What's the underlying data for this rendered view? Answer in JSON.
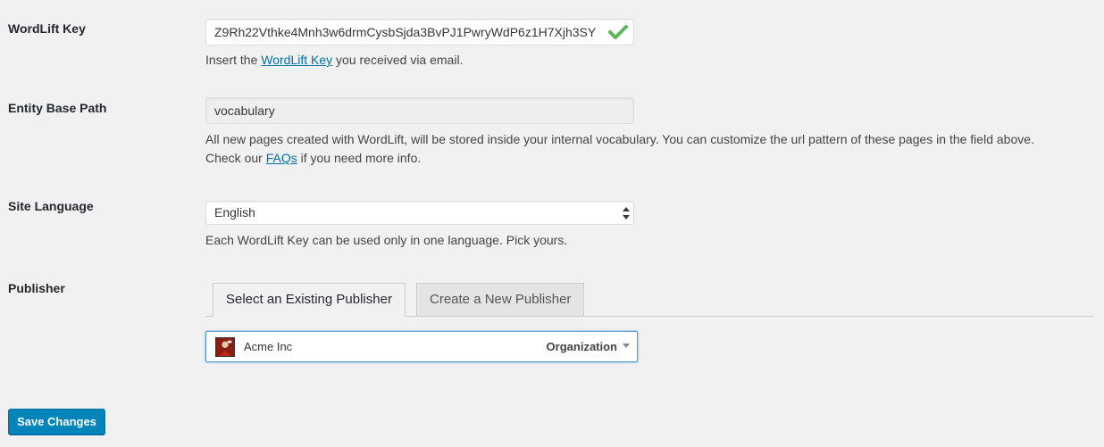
{
  "fields": {
    "key": {
      "label": "WordLift Key",
      "value": "Z9Rh22Vthke4Mnh3w6drmCysbSjda3BvPJ1PwryWdP6z1H7Xjh3SY",
      "desc_before": "Insert the ",
      "desc_link": "WordLift Key",
      "desc_after": " you received via email.",
      "status_icon": "check-icon",
      "status_color": "#5cb85c"
    },
    "base_path": {
      "label": "Entity Base Path",
      "value": "vocabulary",
      "desc_line1": "All new pages created with WordLift, will be stored inside your internal vocabulary. You can customize the url pattern of these pages in the field above.",
      "desc_before": "Check our ",
      "desc_link": "FAQs",
      "desc_after": " if you need more info."
    },
    "language": {
      "label": "Site Language",
      "selected": "English",
      "desc": "Each WordLift Key can be used only in one language. Pick yours."
    },
    "publisher": {
      "label": "Publisher",
      "tabs": [
        {
          "label": "Select an Existing Publisher",
          "active": true
        },
        {
          "label": "Create a New Publisher",
          "active": false
        }
      ],
      "selected": {
        "name": "Acme Inc",
        "type": "Organization",
        "avatar_icon": "publisher-avatar-icon"
      }
    }
  },
  "actions": {
    "save_label": "Save Changes"
  },
  "colors": {
    "primary": "#0085ba",
    "link": "#0073aa",
    "focus_border": "#5b9dd9"
  }
}
